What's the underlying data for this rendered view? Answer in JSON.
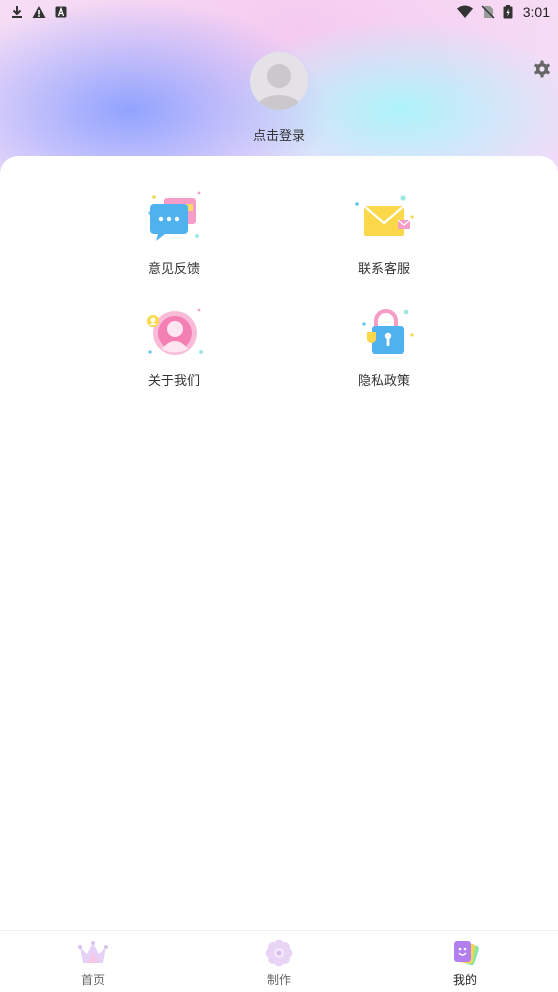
{
  "status_bar": {
    "time": "3:01",
    "left_icons": [
      "download-icon",
      "warning-icon",
      "a-box-icon"
    ],
    "right_icons": [
      "wifi-icon",
      "no-sim-icon",
      "battery-icon"
    ]
  },
  "header": {
    "login_text": "点击登录",
    "settings_icon": "gear-icon"
  },
  "menu": {
    "items": [
      {
        "label": "意见反馈",
        "icon": "feedback-chat-icon"
      },
      {
        "label": "联系客服",
        "icon": "envelope-icon"
      },
      {
        "label": "关于我们",
        "icon": "about-person-icon"
      },
      {
        "label": "隐私政策",
        "icon": "lock-icon"
      }
    ]
  },
  "bottom_nav": {
    "items": [
      {
        "label": "首页",
        "icon": "crown-icon"
      },
      {
        "label": "制作",
        "icon": "flower-icon"
      },
      {
        "label": "我的",
        "icon": "profile-cards-icon",
        "active": true
      }
    ]
  }
}
